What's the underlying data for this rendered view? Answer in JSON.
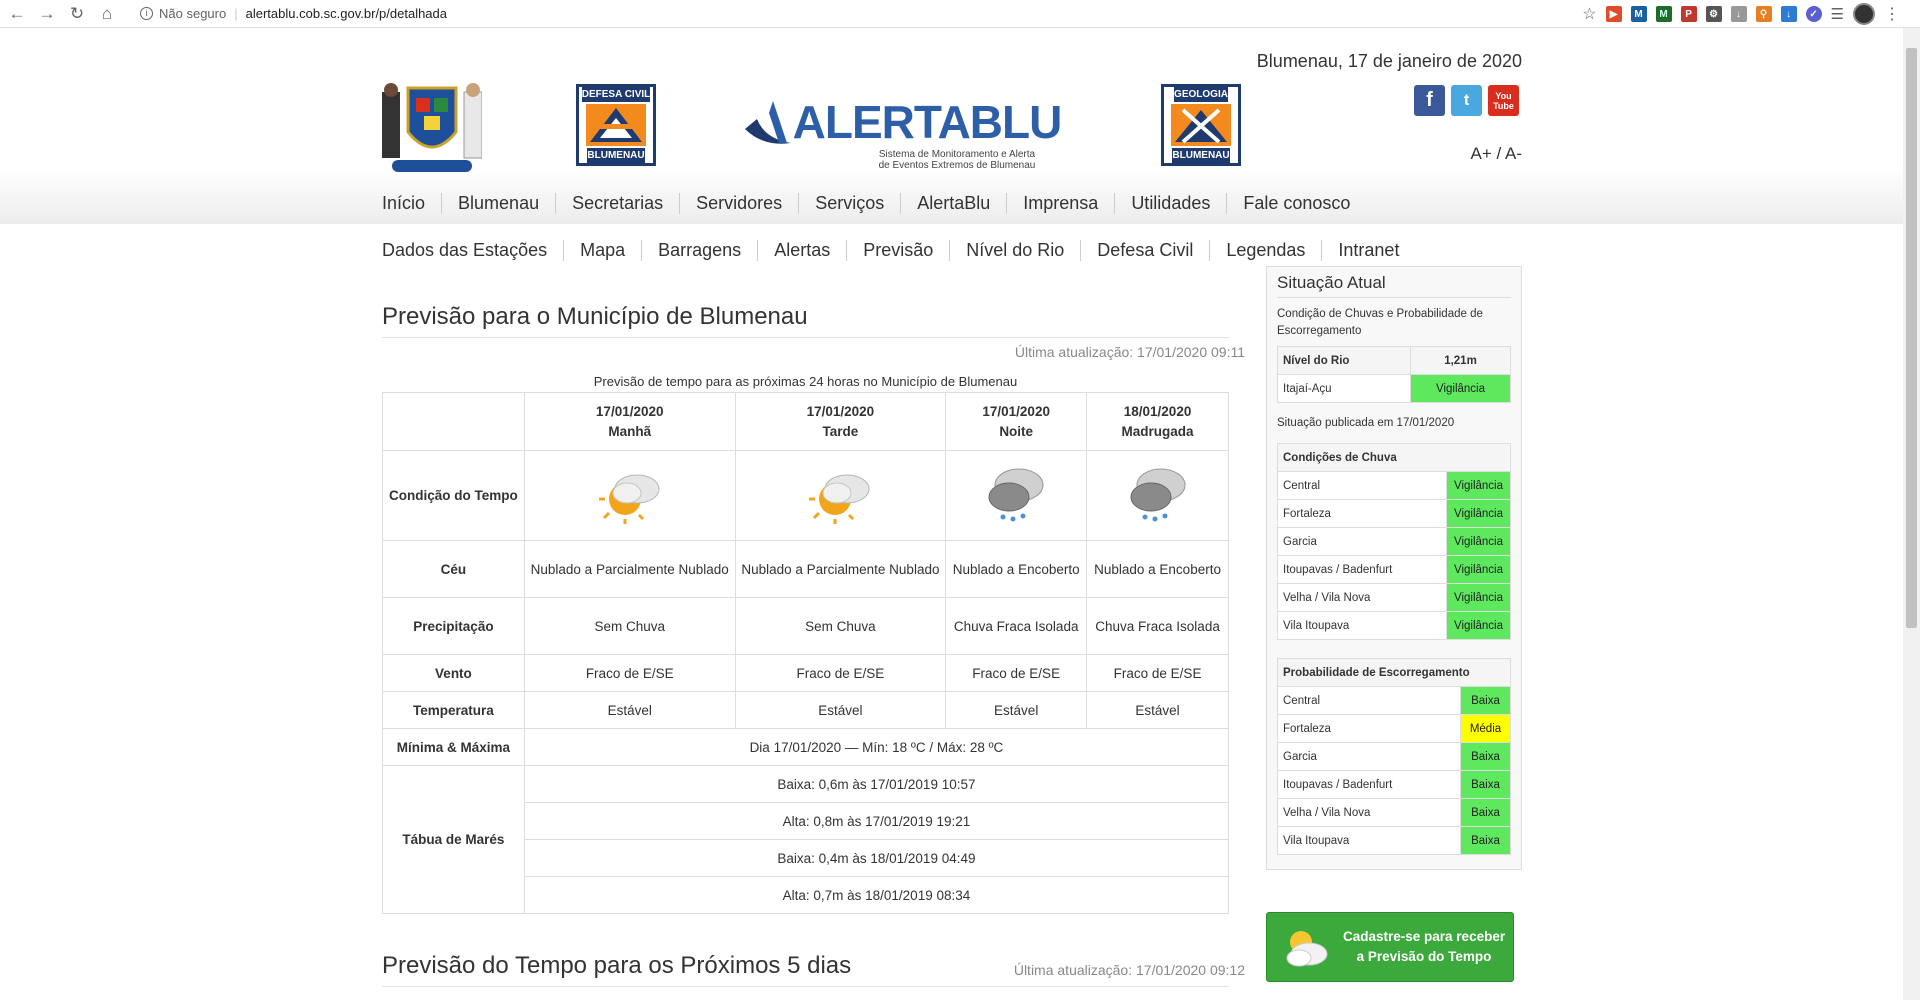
{
  "browser": {
    "security_label": "Não seguro",
    "url": "alertablu.cob.sc.gov.br/p/detalhada"
  },
  "header": {
    "date": "Blumenau, 17 de janeiro de 2020",
    "defesa_civil_top": "DEFESA CIVIL",
    "defesa_civil_bottom": "BLUMENAU",
    "geologia_top": "GEOLOGIA",
    "geologia_bottom": "BLUMENAU",
    "alertablu_title": "ALERTABLU",
    "alertablu_subtitle_1": "Sistema de Monitoramento e Alerta",
    "alertablu_subtitle_2": "de Eventos Extremos de Blumenau",
    "font_controls": "A+ / A-"
  },
  "menu_main": [
    "Início",
    "Blumenau",
    "Secretarias",
    "Servidores",
    "Serviços",
    "AlertaBlu",
    "Imprensa",
    "Utilidades",
    "Fale conosco"
  ],
  "menu_sub": [
    "Dados das Estações",
    "Mapa",
    "Barragens",
    "Alertas",
    "Previsão",
    "Nível do Rio",
    "Defesa Civil",
    "Legendas",
    "Intranet"
  ],
  "main": {
    "title": "Previsão para o Município de Blumenau",
    "updated": "Última atualização: 17/01/2020 09:11",
    "caption": "Previsão de tempo para as próximas 24 horas no Município de Blumenau",
    "columns": [
      {
        "date": "17/01/2020",
        "period": "Manhã"
      },
      {
        "date": "17/01/2020",
        "period": "Tarde"
      },
      {
        "date": "17/01/2020",
        "period": "Noite"
      },
      {
        "date": "18/01/2020",
        "period": "Madrugada"
      }
    ],
    "row_labels": {
      "condicao": "Condição do Tempo",
      "ceu": "Céu",
      "precip": "Precipitação",
      "vento": "Vento",
      "temp": "Temperatura",
      "minmax": "Mínima & Máxima",
      "mares": "Tábua de Marés"
    },
    "ceu": [
      "Nublado a Parcialmente Nublado",
      "Nublado a Parcialmente Nublado",
      "Nublado a Encoberto",
      "Nublado a Encoberto"
    ],
    "precip": [
      "Sem Chuva",
      "Sem Chuva",
      "Chuva Fraca Isolada",
      "Chuva Fraca Isolada"
    ],
    "vento": [
      "Fraco de E/SE",
      "Fraco de E/SE",
      "Fraco de E/SE",
      "Fraco de E/SE"
    ],
    "temp": [
      "Estável",
      "Estável",
      "Estável",
      "Estável"
    ],
    "minmax": "Dia 17/01/2020 — Mín: 18 ºC / Máx: 28 ºC",
    "mares": [
      "Baixa: 0,6m às 17/01/2019 10:57",
      "Alta: 0,8m às 17/01/2019 19:21",
      "Baixa: 0,4m às 18/01/2019 04:49",
      "Alta: 0,7m às 18/01/2019 08:34"
    ],
    "icons": [
      "sun-cloud-icon",
      "sun-cloud-icon",
      "rain-cloud-icon",
      "rain-cloud-icon"
    ],
    "title2": "Previsão do Tempo para os Próximos 5 dias",
    "updated2": "Última atualização: 17/01/2020 09:12"
  },
  "sidebar": {
    "title": "Situação Atual",
    "desc": "Condição de Chuvas e Probabilidade de Escorregamento",
    "river_header": [
      "Nível do Rio",
      "1,21m"
    ],
    "river_row": [
      "Itajaí-Açu",
      "Vigilância"
    ],
    "published": "Situação publicada em 17/01/2020",
    "rain_header": "Condições de Chuva",
    "rain": [
      {
        "region": "Central",
        "status": "Vigilância"
      },
      {
        "region": "Fortaleza",
        "status": "Vigilância"
      },
      {
        "region": "Garcia",
        "status": "Vigilância"
      },
      {
        "region": "Itoupavas / Badenfurt",
        "status": "Vigilância"
      },
      {
        "region": "Velha / Vila Nova",
        "status": "Vigilância"
      },
      {
        "region": "Vila Itoupava",
        "status": "Vigilância"
      }
    ],
    "slide_header": "Probabilidade de Escorregamento",
    "slide": [
      {
        "region": "Central",
        "status": "Baixa"
      },
      {
        "region": "Fortaleza",
        "status": "Média"
      },
      {
        "region": "Garcia",
        "status": "Baixa"
      },
      {
        "region": "Itoupavas / Badenfurt",
        "status": "Baixa"
      },
      {
        "region": "Velha / Vila Nova",
        "status": "Baixa"
      },
      {
        "region": "Vila Itoupava",
        "status": "Baixa"
      }
    ],
    "cta_line1": "Cadastre-se para receber",
    "cta_line2": "a Previsão do Tempo"
  },
  "colors": {
    "status_green": "#5ee85e",
    "status_yellow": "#ffff00",
    "cta_green": "#3ba93b",
    "brand_blue": "#2d5ea8"
  }
}
